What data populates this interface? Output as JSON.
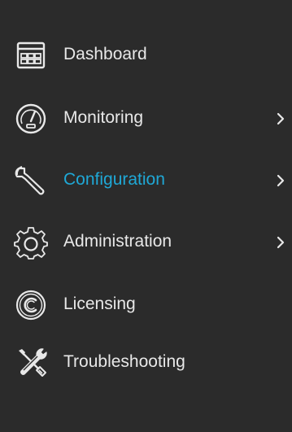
{
  "colors": {
    "background": "#2b2b2b",
    "text": "#e8e8e8",
    "active_text": "#1fa8d6",
    "icon": "#e8e8e8"
  },
  "sidebar": {
    "items": [
      {
        "label": "Dashboard",
        "icon": "dashboard-icon",
        "has_submenu": false,
        "active": false
      },
      {
        "label": "Monitoring",
        "icon": "gauge-icon",
        "has_submenu": true,
        "active": false
      },
      {
        "label": "Configuration",
        "icon": "wrench-icon",
        "has_submenu": true,
        "active": true
      },
      {
        "label": "Administration",
        "icon": "gear-icon",
        "has_submenu": true,
        "active": false
      },
      {
        "label": "Licensing",
        "icon": "copyright-icon",
        "has_submenu": false,
        "active": false
      },
      {
        "label": "Troubleshooting",
        "icon": "tools-icon",
        "has_submenu": false,
        "active": false
      }
    ]
  }
}
